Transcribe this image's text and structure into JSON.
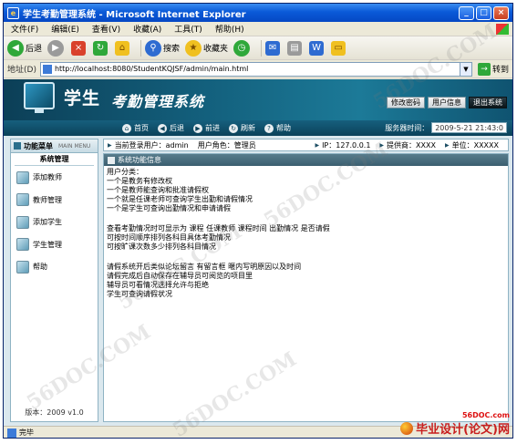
{
  "window": {
    "title": "学生考勤管理系统 - Microsoft Internet Explorer",
    "min": "_",
    "max": "□",
    "close": "×"
  },
  "menubar": {
    "items": [
      "文件(F)",
      "编辑(E)",
      "查看(V)",
      "收藏(A)",
      "工具(T)",
      "帮助(H)"
    ]
  },
  "toolbar": {
    "back": "后退",
    "search": "搜索",
    "favorites": "收藏夹"
  },
  "address": {
    "label": "地址(D)",
    "url": "http://localhost:8080/StudentKQJSF/admin/main.html",
    "go": "转到"
  },
  "app": {
    "title_plain": "学生",
    "title_em": "考勤管理系统",
    "links": {
      "change_password": "修改密码",
      "user_info": "用户信息",
      "logout": "退出系统"
    },
    "nav": {
      "home": "首页",
      "back": "后退",
      "forward": "前进",
      "refresh": "刷新",
      "help": "帮助"
    },
    "server_time_label": "服务器时间：",
    "server_time": "2009-5-21 21:43:0"
  },
  "sidebar": {
    "title": "功能菜单",
    "title_en": "MAIN MENU",
    "group": "系统管理",
    "items": [
      {
        "label": "添加教师",
        "icon": "add-teacher-icon"
      },
      {
        "label": "教师管理",
        "icon": "teacher-manage-icon"
      },
      {
        "label": "添加学生",
        "icon": "add-student-icon"
      },
      {
        "label": "学生管理",
        "icon": "student-manage-icon"
      },
      {
        "label": "帮助",
        "icon": "help-icon"
      }
    ],
    "version": "版本：2009 v1.0"
  },
  "infobar": {
    "current_user": "当前登录用户：admin",
    "user_role": "用户角色：管理员",
    "ip": "IP：127.0.0.1",
    "provider": "提供商：XXXX",
    "unit": "单位：XXXXX"
  },
  "panel": {
    "title": "系统功能信息",
    "lines_1": [
      "用户分类：",
      "一个是教务有修改权",
      "一个是教师能查询和批准请假权",
      "一个就是任课老师可查询学生出勤和请假情况",
      "一个是学生可查询出勤情况和申请请假"
    ],
    "lines_2": [
      "查看考勤情况时可显示为  课程 任课教师 课程时间 出勤情况 是否请假",
      "可按时间顺序排列各科目具体考勤情况",
      "可按旷课次数多少排列各科目情况"
    ],
    "lines_3": [
      "请假系统开后类似论坛留言 有留言框 暱内写明原因以及时间",
      "请假完成后自动保存在辅导员可阅览的项目里",
      "辅导员可看情况选择允许与拒绝",
      "学生可查询请假状况"
    ]
  },
  "statusbar": {
    "text": "完毕"
  },
  "brand": {
    "url": "56DOC.com",
    "name": "毕业设计(论文)网"
  }
}
